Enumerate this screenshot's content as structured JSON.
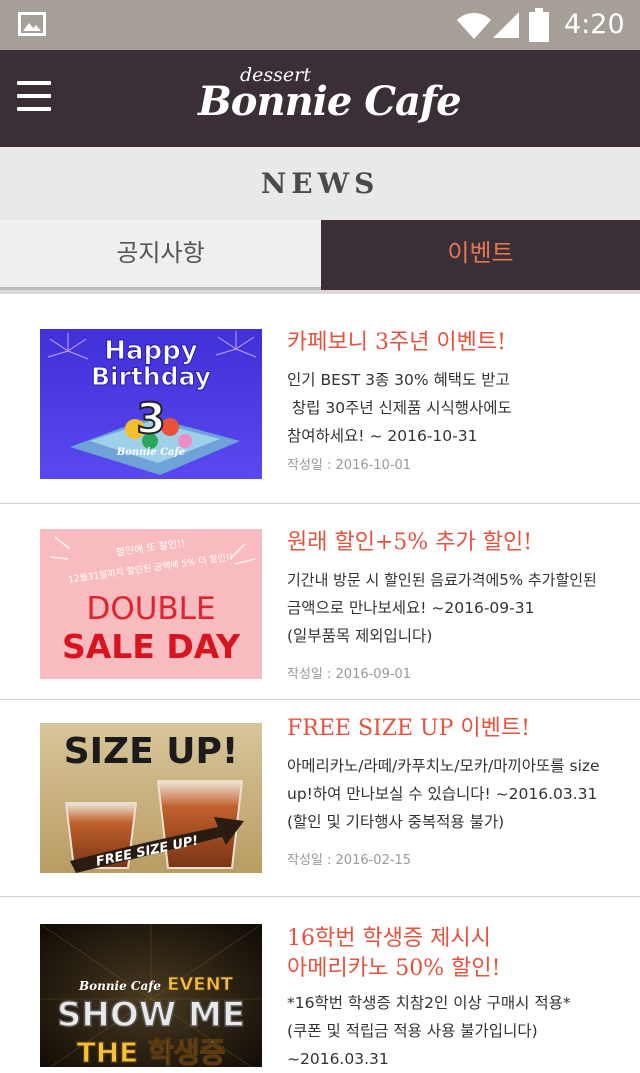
{
  "status_bar": {
    "time": "4:20",
    "icons": [
      "image-icon",
      "wifi-icon",
      "signal-icon",
      "battery-icon"
    ]
  },
  "header": {
    "logo_small": "dessert",
    "logo_big": "Bonnie Cafe",
    "menu_icon": "hamburger-icon"
  },
  "page": {
    "title": "NEWS"
  },
  "tabs": [
    {
      "label": "공지사항",
      "active": false
    },
    {
      "label": "이벤트",
      "active": true
    }
  ],
  "colors": {
    "status_bar": "#a59f97",
    "header_bg": "#3a2f36",
    "accent": "#e8523b",
    "active_tab_text": "#e27752"
  },
  "events": [
    {
      "title": "카페보니 3주년 이벤트!",
      "desc": [
        "인기 BEST 3종 30% 혜택도 받고",
        " 창립 30주년 신제품 시식행사에도",
        "참여하세요! ~ 2016-10-31"
      ],
      "date": "작성일 : 2016-10-01",
      "image": {
        "line1": "Happy",
        "line2": "Birthday",
        "number": "3",
        "brand": "Bonnie Cafe"
      }
    },
    {
      "title": "원래 할인+5% 추가 할인!",
      "desc": [
        "기간내 방문 시 할인된 음료가격에5% 추가할인된",
        "금액으로 만나보세요! ~2016-09-31",
        "(일부품목 제외입니다)"
      ],
      "date": "작성일 : 2016-09-01",
      "image": {
        "line1": "DOUBLE",
        "line2": "SALE DAY"
      }
    },
    {
      "title": "FREE SIZE UP 이벤트!",
      "desc": [
        "아메리카노/라떼/카푸치노/모카/마끼아또를 size",
        "up!하여 만나보실 수 있습니다! ~2016.03.31",
        "(할인 및 기타행사 중복적용 불가)"
      ],
      "date": "작성일 : 2016-02-15",
      "image": {
        "line1": "SIZE UP!",
        "arrow_text": "FREE SIZE UP!"
      }
    },
    {
      "title": "16학번 학생증 제시시\n아메리카노 50% 할인!",
      "title_lines": [
        "16학번 학생증 제시시",
        "아메리카노 50% 할인!"
      ],
      "desc": [
        "*16학번 학생증 치참2인 이상 구매시 적용*",
        "(쿠폰 및 적립금 적용 사용 불가입니다)",
        "~2016.03.31"
      ],
      "image": {
        "brand": "Bonnie Cafe",
        "event": "EVENT",
        "line1": "SHOW ME",
        "line2": "THE 학생증"
      }
    }
  ]
}
